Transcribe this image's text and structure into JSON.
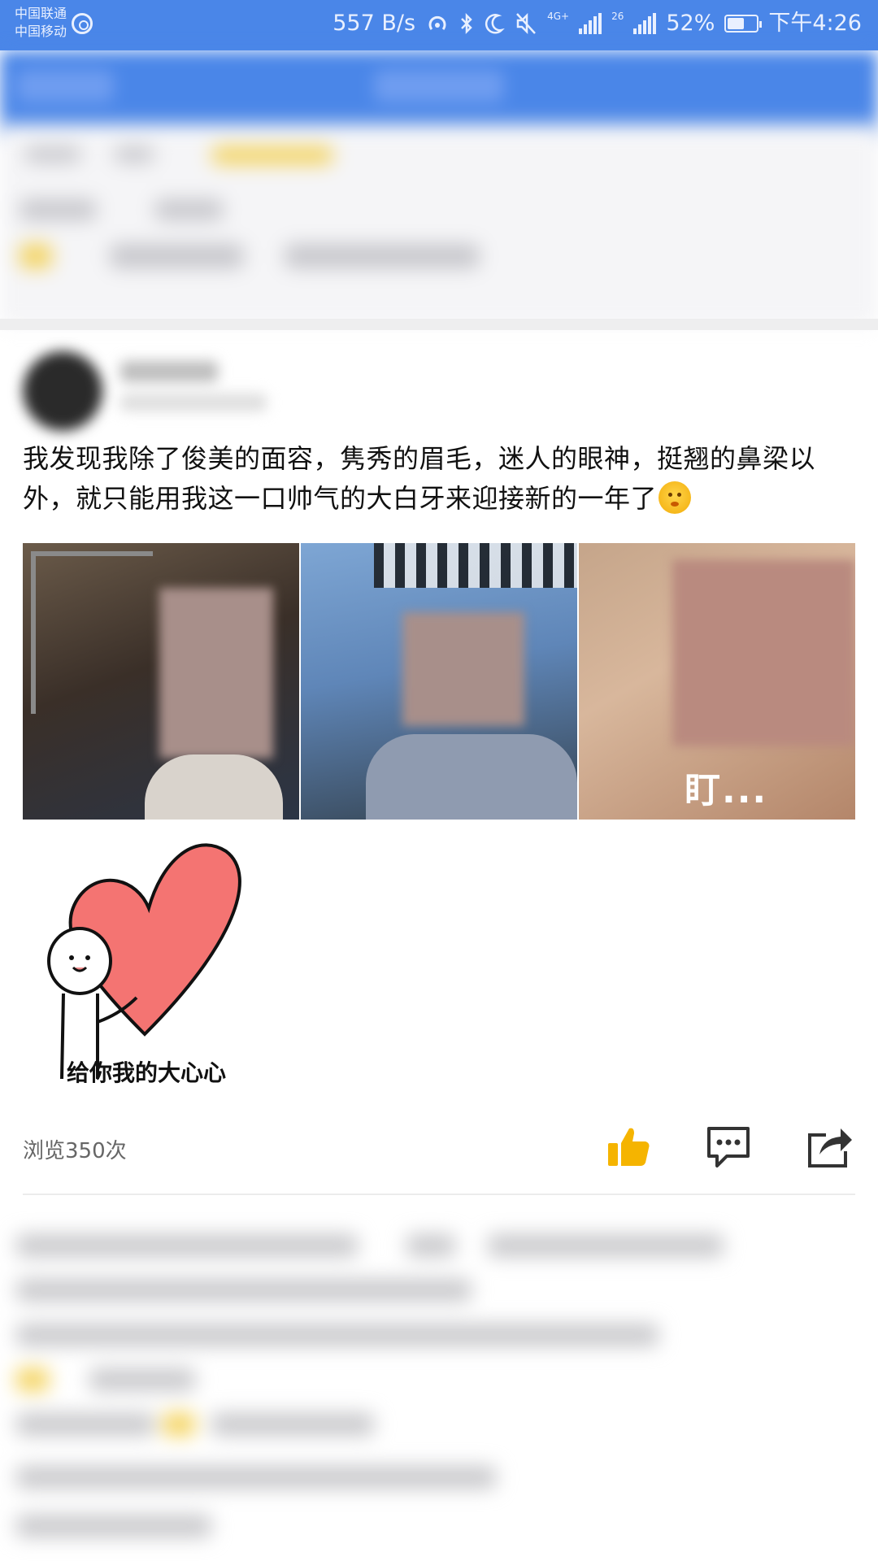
{
  "status_bar": {
    "carrier_1": "中国联通",
    "carrier_2": "中国移动",
    "net_speed": "557 B/s",
    "battery": "52%",
    "time": "下午4:26",
    "network_labels": [
      "4G+",
      "26"
    ],
    "icons": [
      "carrier-signal-icon",
      "hotspot-icon",
      "bluetooth-icon",
      "moon-icon",
      "mute-icon",
      "signal-icon",
      "signal-icon",
      "battery-icon"
    ]
  },
  "post": {
    "text": "我发现我除了俊美的面容，隽秀的眉毛，迷人的眼神，挺翘的鼻梁以外，就只能用我这一口帅气的大白牙来迎接新的一年了",
    "photo_caption": "盯...",
    "sticker_caption": "给你我的大心心",
    "views": "浏览350次",
    "colors": {
      "like": "#F5B400",
      "icon": "#333333",
      "header": "#4A86E8"
    }
  }
}
